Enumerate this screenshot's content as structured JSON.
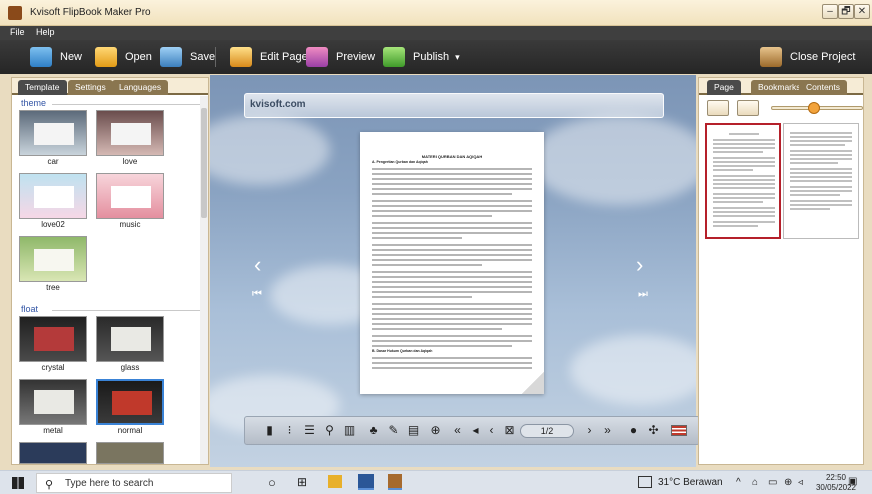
{
  "window": {
    "title": "Kvisoft FlipBook Maker Pro",
    "controls": [
      "–",
      "🗗",
      "✕"
    ]
  },
  "menu": [
    "File",
    "Help"
  ],
  "toolbar": {
    "new": "New",
    "open": "Open",
    "save": "Save",
    "edit_page": "Edit Page",
    "preview": "Preview",
    "publish": "Publish",
    "publish_arrow": "▾",
    "close_project": "Close Project"
  },
  "left_panel": {
    "tabs": [
      "Template",
      "Settings",
      "Languages"
    ],
    "sections": [
      {
        "title": "theme",
        "items": [
          "car",
          "love",
          "love02",
          "music",
          "tree"
        ]
      },
      {
        "title": "float",
        "items": [
          "crystal",
          "glass",
          "metal",
          "normal"
        ]
      }
    ]
  },
  "center": {
    "site": "kvisoft.com",
    "page_indicator": "1/2",
    "page_heading": "MATERI QURBAN DAN AQIQAH",
    "sub_heading_a": "A. Pengertian Qurban dan Aqiqah",
    "sub_heading_b": "B. Dasar Hukum Qurban dan Aqiqah"
  },
  "right_panel": {
    "tabs": [
      "Page",
      "Bookmarks",
      "Contents"
    ],
    "zoom_level": 0.45
  },
  "taskbar": {
    "search_placeholder": "Type here to search",
    "weather": "31°C  Berawan",
    "time": "22:50",
    "date": "30/05/2022"
  },
  "colors": {
    "accent": "#b5202a",
    "toolbar_bg": "#2e2e2e",
    "panel_tab": "#8a7650"
  }
}
